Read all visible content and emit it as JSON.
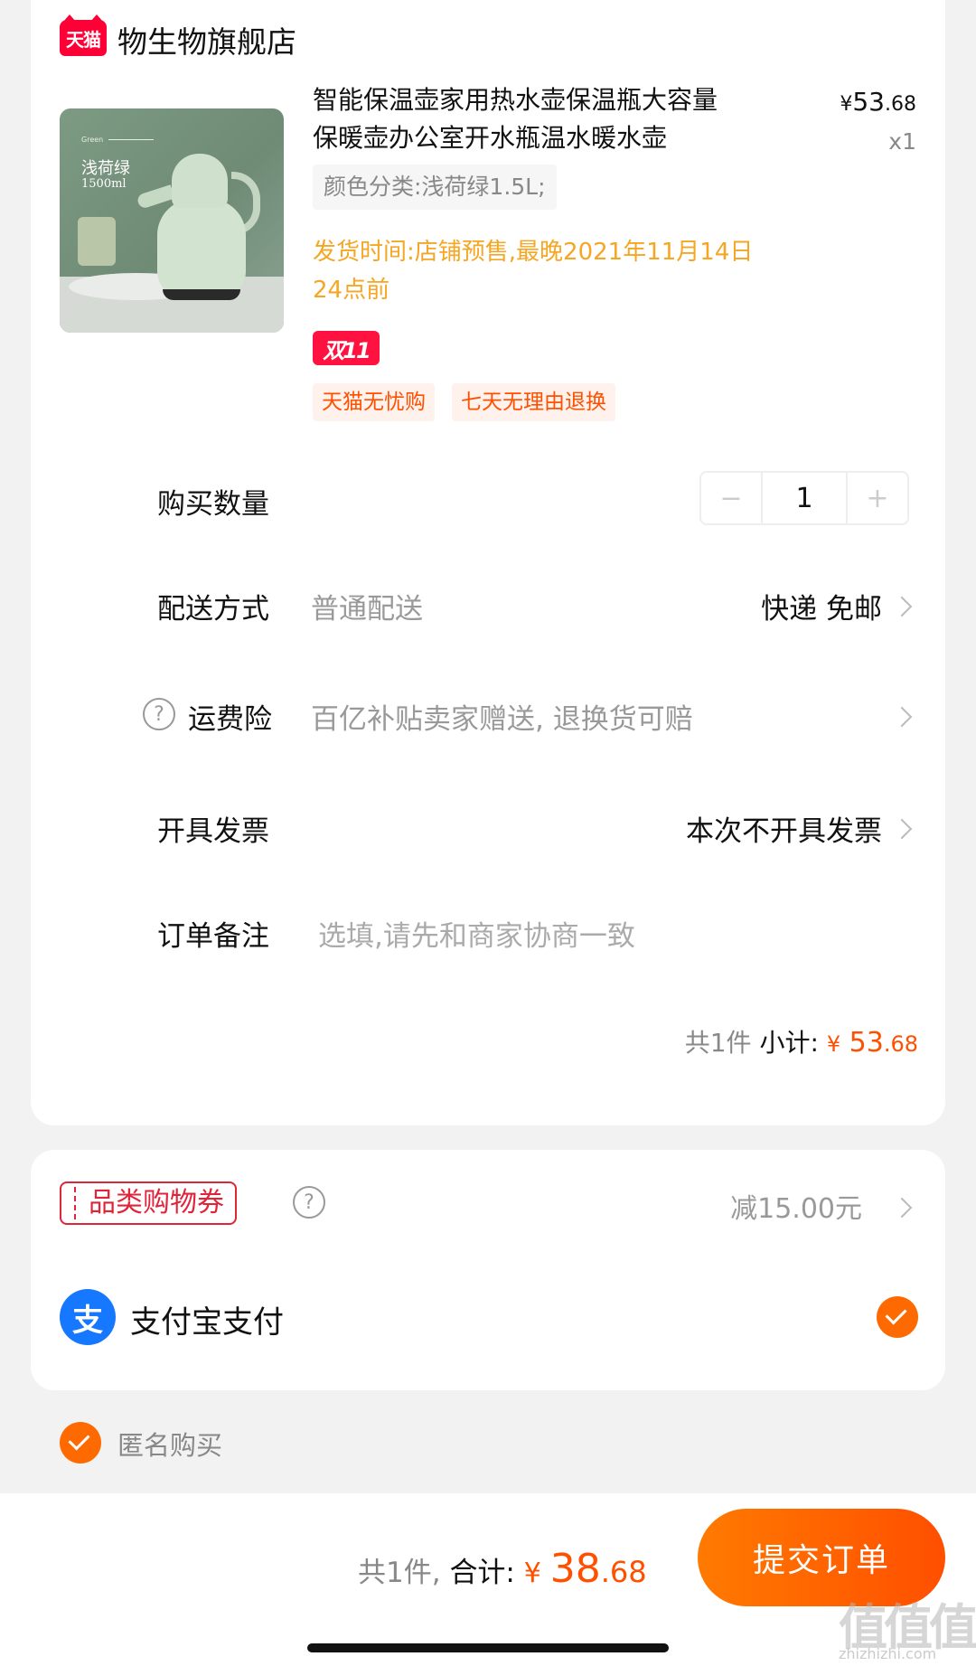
{
  "store": {
    "badge": "天猫",
    "name": "物生物旗舰店"
  },
  "product": {
    "image_label": "浅荷绿",
    "image_sub": "1500ml",
    "image_green": "Green",
    "title": "智能保温壶家用热水壶保温瓶大容量保暖壶办公室开水瓶温水暖水壶",
    "price_yen": "¥",
    "price_int": "53",
    "price_dec": ".68",
    "qty_mark": "x1",
    "spec": "颜色分类:浅荷绿1.5L;",
    "ship_time": "发货时间:店铺预售,最晚2021年11月14日24点前",
    "promo_badge": "双11",
    "services": [
      "天猫无忧购",
      "七天无理由退换"
    ]
  },
  "rows": {
    "quantity": {
      "label": "购买数量",
      "value": "1",
      "minus": "−",
      "plus": "+"
    },
    "delivery": {
      "label": "配送方式",
      "sub": "普通配送",
      "value": "快递 免邮"
    },
    "freight_insurance": {
      "label": "运费险",
      "sub": "百亿补贴卖家赠送, 退换货可赔"
    },
    "invoice": {
      "label": "开具发票",
      "value": "本次不开具发票"
    },
    "note": {
      "label": "订单备注",
      "placeholder": "选填,请先和商家协商一致"
    }
  },
  "subtotal": {
    "count": "共1件",
    "label": "小计:",
    "yen": "¥",
    "int": "53",
    "dec": ".68"
  },
  "payment": {
    "coupon_label": "品类购物券",
    "coupon_value": "减15.00元",
    "alipay_icon": "支",
    "alipay_label": "支付宝支付"
  },
  "anonymous": {
    "label": "匿名购买"
  },
  "bottom": {
    "count": "共1件,",
    "total_label": "合计:",
    "yen": "¥",
    "int": "38",
    "dec": ".68",
    "submit": "提交订单"
  },
  "watermark": {
    "main": "值值值",
    "sub": "zhizhizhi.com"
  },
  "colors": {
    "accent": "#ff5000",
    "tmall_red": "#ff0036",
    "alipay_blue": "#1677ff",
    "ship_yellow": "#f5a623"
  },
  "icons": [
    "tmall-icon",
    "help-icon",
    "chevron-right-icon",
    "check-icon",
    "alipay-icon",
    "coupon-icon"
  ]
}
